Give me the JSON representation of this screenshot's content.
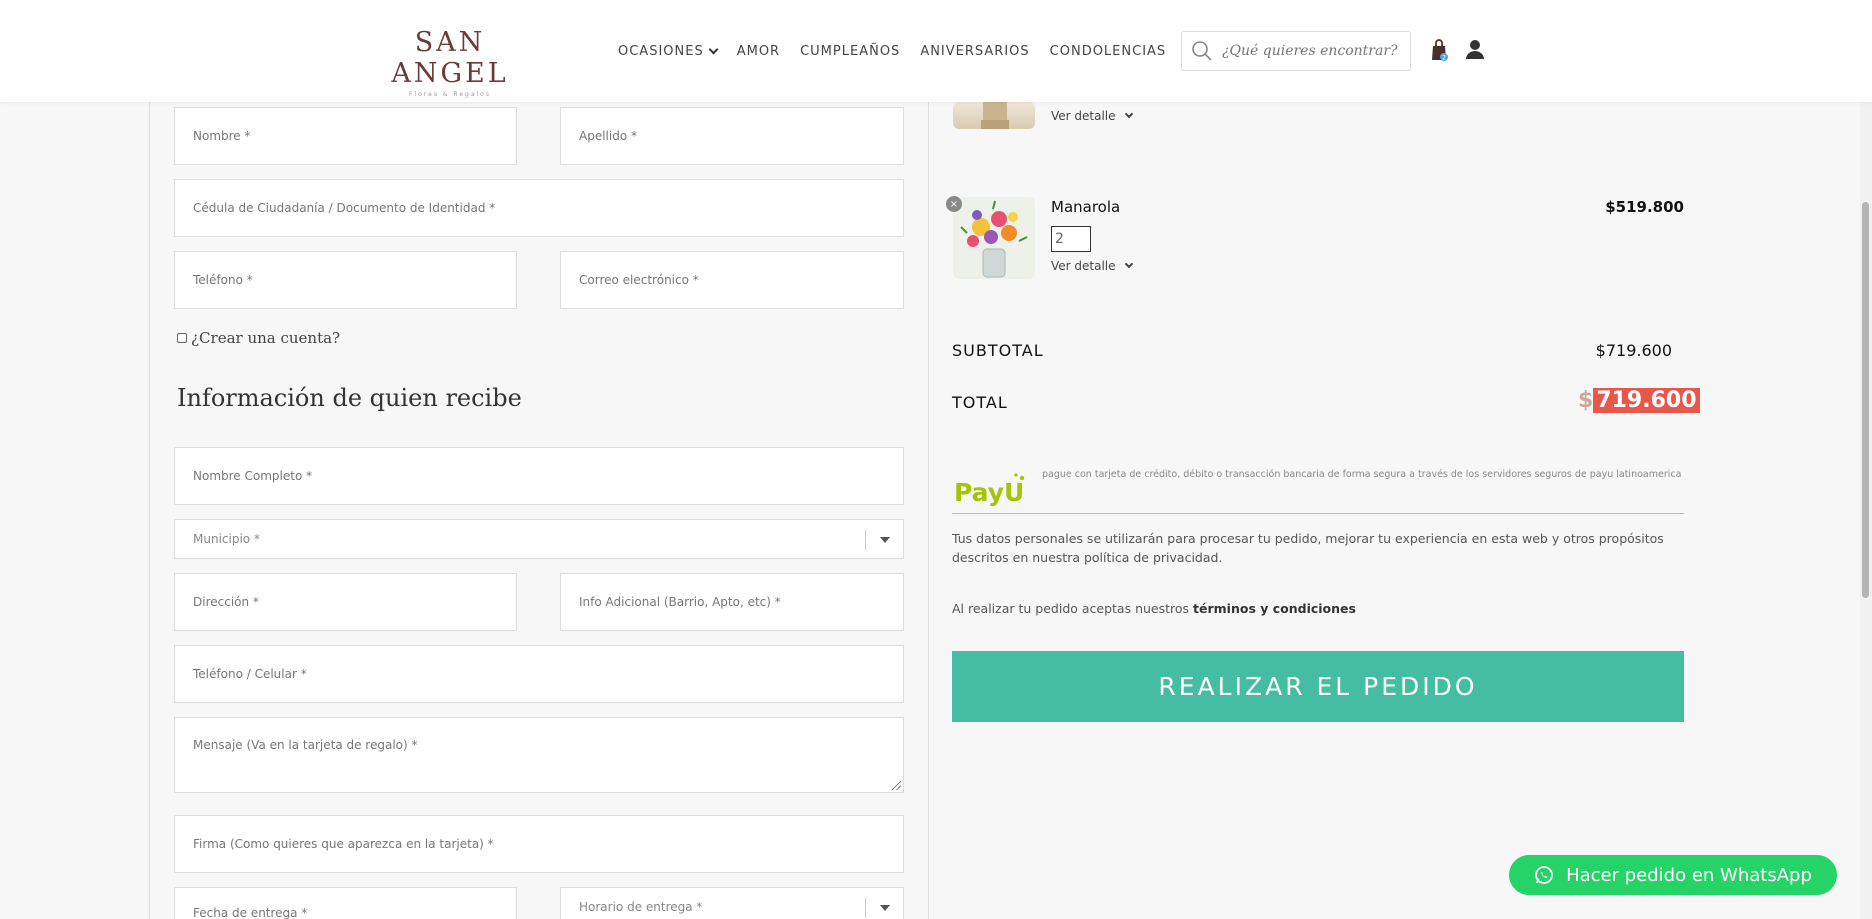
{
  "header": {
    "logo_main": "SAN ANGEL",
    "logo_sub": "Flores & Regalos",
    "nav": [
      {
        "label": "OCASIONES",
        "has_dropdown": true
      },
      {
        "label": "AMOR"
      },
      {
        "label": "CUMPLEAÑOS"
      },
      {
        "label": "ANIVERSARIOS"
      },
      {
        "label": "CONDOLENCIAS"
      }
    ],
    "search_placeholder": "¿Qué quieres encontrar?",
    "cart_count": "2"
  },
  "billing": {
    "nombre": "Nombre *",
    "apellido": "Apellido *",
    "cedula": "Cédula de Ciudadanía / Documento de Identidad *",
    "telefono": "Teléfono *",
    "correo": "Correo electrónico *",
    "crear_cuenta": "¿Crear una cuenta?"
  },
  "recipient": {
    "title": "Información de quien recibe",
    "nombre_completo": "Nombre Completo *",
    "municipio": "Municipio *",
    "direccion": "Dirección *",
    "info_adicional": "Info Adicional (Barrio, Apto, etc) *",
    "telefono_celular": "Teléfono / Celular *",
    "mensaje": "Mensaje (Va en la tarjeta de regalo) *",
    "firma": "Firma (Como quieres que aparezca en la tarjeta) *",
    "fecha_entrega": "Fecha de entrega *",
    "horario_entrega": "Horario de entrega *"
  },
  "order": {
    "items": [
      {
        "name": "",
        "qty": "",
        "detail_label": "Ver detalle"
      },
      {
        "name": "Manarola",
        "qty": "2",
        "price": "$519.800",
        "detail_label": "Ver detalle"
      }
    ],
    "remove_symbol": "×",
    "subtotal_label": "SUBTOTAL",
    "subtotal_value": "$719.600",
    "total_label": "TOTAL",
    "total_currency": "$",
    "total_amount": "719.600",
    "payu_text": "pague con tarjeta de crédito, débito o transacción bancaria de forma segura a través de los servidores seguros de payu latinoamerica",
    "privacy_text": "Tus datos personales se utilizarán para procesar tu pedido, mejorar tu experiencia en esta web y otros propósitos descritos en nuestra política de privacidad.",
    "terms_prefix": "Al realizar tu pedido aceptas nuestros ",
    "terms_link": "términos y condiciones",
    "place_order": "REALIZAR EL PEDIDO"
  },
  "whatsapp": {
    "label": "Hacer pedido en WhatsApp"
  },
  "colors": {
    "brand": "#6b3a3a",
    "order_button": "#45bda2",
    "whatsapp": "#25d366",
    "total_highlight": "#e8574a"
  },
  "icons": {
    "search": "search-icon",
    "cart": "shopping-bag-icon",
    "user": "user-icon",
    "whatsapp": "whatsapp-icon",
    "remove": "close-icon"
  }
}
